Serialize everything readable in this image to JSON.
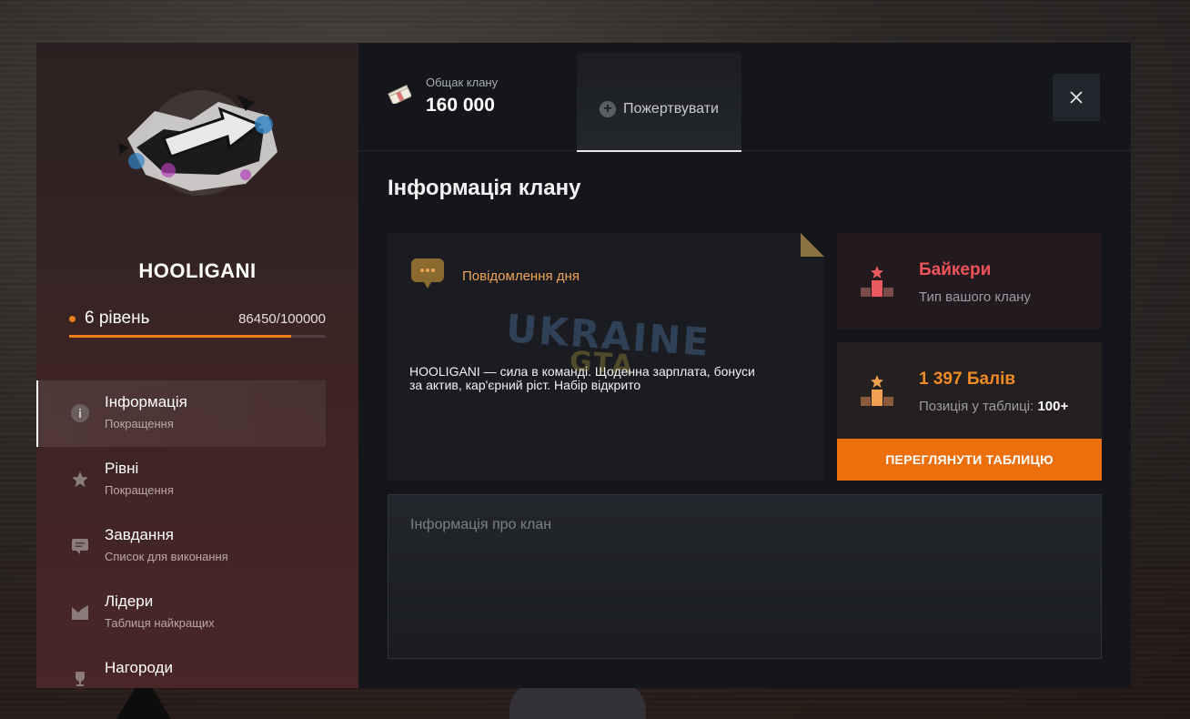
{
  "clan": {
    "name": "HOOLIGANI",
    "level_label": "6 рівень",
    "xp_text": "86450/100000",
    "xp_fraction": 0.8645
  },
  "sidebar": {
    "items": [
      {
        "title": "Інформація",
        "sub": "Покращення",
        "icon": "info-icon"
      },
      {
        "title": "Рівні",
        "sub": "Покращення",
        "icon": "star-icon"
      },
      {
        "title": "Завдання",
        "sub": "Список для виконання",
        "icon": "message-icon"
      },
      {
        "title": "Лідери",
        "sub": "Таблиця найкращих",
        "icon": "chart-icon"
      },
      {
        "title": "Нагороди",
        "sub": "",
        "icon": "trophy-icon"
      }
    ]
  },
  "topbar": {
    "treasury_label": "Общак клану",
    "treasury_value": "160 000",
    "donate_label": "Пожертвувати"
  },
  "main": {
    "section_title": "Інформація клану",
    "motd_title": "Повідомлення дня",
    "motd_text": "HOOLIGANI — сила в команді. Щоденна зарплата, бонуси за актив, кар'єрний ріст. Набір відкрито",
    "watermark_top": "UKRAINE",
    "watermark_bottom": "GTA",
    "clan_type_title": "Байкери",
    "clan_type_sub": "Тип вашого клану",
    "score_title": "1 397 Балів",
    "score_sub": "Позиція у таблиці:",
    "score_position": "100+",
    "table_button": "ПЕРЕГЛЯНУТИ ТАБЛИЦЮ",
    "info_placeholder": "Інформація про клан"
  },
  "colors": {
    "accent": "#ec6f0e",
    "type_title": "#f0525a",
    "score_title": "#f08a24"
  }
}
